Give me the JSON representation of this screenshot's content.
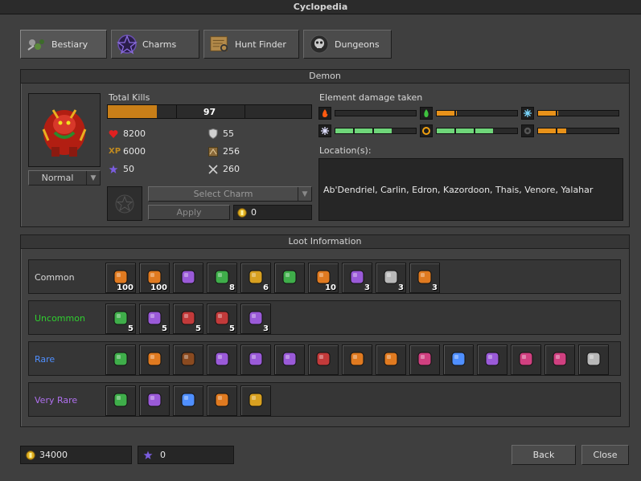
{
  "window": {
    "title": "Cyclopedia"
  },
  "tabs": [
    {
      "label": "Bestiary",
      "icon": "bestiary-icon"
    },
    {
      "label": "Charms",
      "icon": "charms-icon"
    },
    {
      "label": "Hunt Finder",
      "icon": "hunt-finder-icon"
    },
    {
      "label": "Dungeons",
      "icon": "dungeons-icon"
    }
  ],
  "creature": {
    "name": "Demon",
    "difficulty": "Normal",
    "total_kills_label": "Total Kills",
    "kills": "97",
    "kills_progress": 0.24,
    "health": "8200",
    "experience": "6000",
    "charm_points": "50",
    "armor": "55",
    "speed": "256",
    "defense": "260",
    "select_charm": "Select Charm",
    "apply": "Apply",
    "charm_cost": "0"
  },
  "elements": {
    "label": "Element damage taken",
    "items": [
      {
        "name": "fire",
        "color": "#e8921a",
        "fill": 0.0,
        "icon": "fire-icon"
      },
      {
        "name": "earth",
        "color": "#e8921a",
        "fill": 0.25,
        "icon": "earth-icon"
      },
      {
        "name": "ice",
        "color": "#e8921a",
        "fill": 0.25,
        "icon": "ice-icon"
      },
      {
        "name": "energy",
        "color": "#6fd67a",
        "fill": 0.7,
        "icon": "energy-icon"
      },
      {
        "name": "holy",
        "color": "#6fd67a",
        "fill": 0.7,
        "icon": "holy-icon"
      },
      {
        "name": "death",
        "color": "#e8921a",
        "fill": 0.35,
        "icon": "death-icon"
      }
    ]
  },
  "locations": {
    "label": "Location(s):",
    "text": "Ab'Dendriel, Carlin, Edron, Kazordoon, Thais, Venore, Yalahar"
  },
  "loot": {
    "title": "Loot Information",
    "rows": [
      {
        "label": "Common",
        "color": "#d8d8d8",
        "items": [
          {
            "icon": "gold-coin-icon",
            "count": "100"
          },
          {
            "icon": "gold-coin-icon",
            "count": "100"
          },
          {
            "icon": "small-amethyst-icon",
            "count": ""
          },
          {
            "icon": "platinum-coin-icon",
            "count": "8"
          },
          {
            "icon": "fire-mushroom-icon",
            "count": "6"
          },
          {
            "icon": "demon-horn-icon",
            "count": ""
          },
          {
            "icon": "great-spirit-potion-icon",
            "count": "10"
          },
          {
            "icon": "great-mana-potion-icon",
            "count": "3"
          },
          {
            "icon": "ultimate-health-potion-icon",
            "count": "3"
          },
          {
            "icon": "demon-dust-icon",
            "count": "3"
          }
        ]
      },
      {
        "label": "Uncommon",
        "color": "#2fd02f",
        "items": [
          {
            "icon": "small-emerald-icon",
            "count": "5"
          },
          {
            "icon": "small-amethyst-icon",
            "count": "5"
          },
          {
            "icon": "small-ruby-icon",
            "count": "5"
          },
          {
            "icon": "small-topaz-icon",
            "count": "5"
          },
          {
            "icon": "demonic-essence-icon",
            "count": "3"
          }
        ]
      },
      {
        "label": "Rare",
        "color": "#4f8fff",
        "items": [
          {
            "icon": "spellbook-icon",
            "count": ""
          },
          {
            "icon": "fire-axe-icon",
            "count": ""
          },
          {
            "icon": "red-gem-icon",
            "count": ""
          },
          {
            "icon": "ring-icon",
            "count": ""
          },
          {
            "icon": "energy-ring-icon",
            "count": ""
          },
          {
            "icon": "silver-amulet-icon",
            "count": ""
          },
          {
            "icon": "assassin-star-icon",
            "count": ""
          },
          {
            "icon": "gold-ring-icon",
            "count": ""
          },
          {
            "icon": "might-ring-icon",
            "count": ""
          },
          {
            "icon": "giant-sword-icon",
            "count": ""
          },
          {
            "icon": "ice-rapier-icon",
            "count": ""
          },
          {
            "icon": "golden-sickle-icon",
            "count": ""
          },
          {
            "icon": "fire-axe-weapon-icon",
            "count": ""
          },
          {
            "icon": "devil-helmet-icon",
            "count": ""
          },
          {
            "icon": "demon-shield-icon",
            "count": ""
          }
        ]
      },
      {
        "label": "Very Rare",
        "color": "#b070f0",
        "items": [
          {
            "icon": "golden-legs-icon",
            "count": ""
          },
          {
            "icon": "magic-plate-armor-icon",
            "count": ""
          },
          {
            "icon": "mastermind-shield-icon",
            "count": ""
          },
          {
            "icon": "demonrage-sword-icon",
            "count": ""
          },
          {
            "icon": "demon-trophy-icon",
            "count": ""
          }
        ]
      }
    ]
  },
  "footer": {
    "gold": "34000",
    "charm_points": "0",
    "back": "Back",
    "close": "Close"
  }
}
